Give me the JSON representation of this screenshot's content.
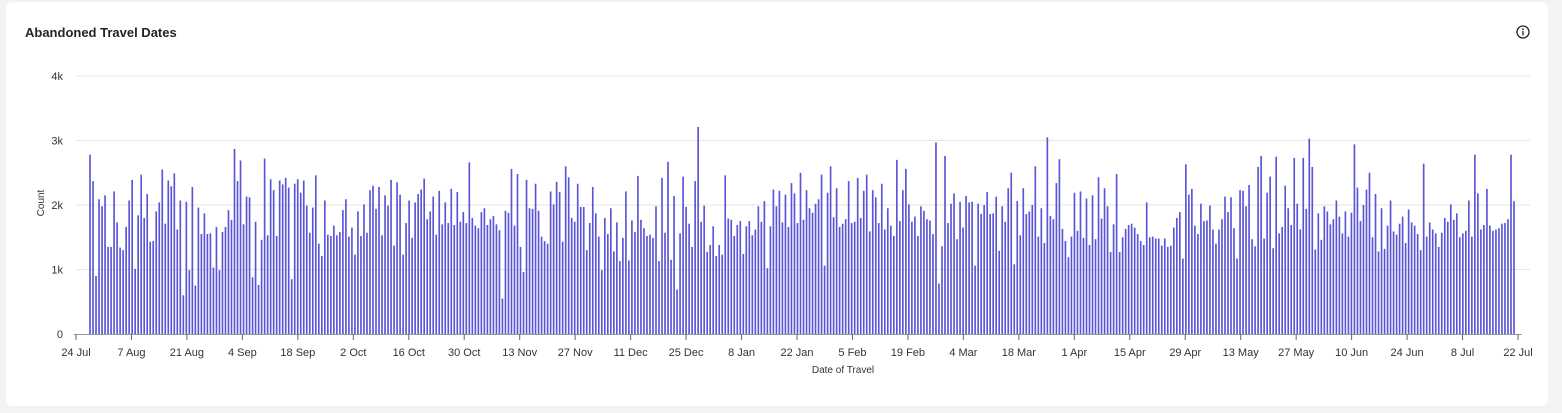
{
  "card": {
    "title": "Abandoned Travel Dates",
    "info_icon": "info-circle-icon"
  },
  "chart_data": {
    "type": "bar",
    "title": "Abandoned Travel Dates",
    "xlabel": "Date of Travel",
    "ylabel": "Count",
    "ylim": [
      0,
      4000
    ],
    "y_ticks": [
      {
        "value": 0,
        "label": "0"
      },
      {
        "value": 1000,
        "label": "1k"
      },
      {
        "value": 2000,
        "label": "2k"
      },
      {
        "value": 3000,
        "label": "3k"
      },
      {
        "value": 4000,
        "label": "4k"
      }
    ],
    "x_ticks": [
      "24 Jul",
      "7 Aug",
      "21 Aug",
      "4 Sep",
      "18 Sep",
      "2 Oct",
      "16 Oct",
      "30 Oct",
      "13 Nov",
      "27 Nov",
      "11 Dec",
      "25 Dec",
      "8 Jan",
      "22 Jan",
      "5 Feb",
      "19 Feb",
      "4 Mar",
      "18 Mar",
      "1 Apr",
      "15 Apr",
      "29 Apr",
      "13 May",
      "27 May",
      "10 Jun",
      "24 Jun",
      "8 Jul",
      "22 Jul"
    ],
    "grid": true,
    "bar_color": "#5a55d6",
    "values": [
      2780,
      2370,
      900,
      2090,
      1980,
      2150,
      1350,
      1350,
      2210,
      1730,
      1340,
      1300,
      1660,
      2070,
      2390,
      1010,
      1840,
      2470,
      1800,
      2170,
      1430,
      1440,
      1900,
      2040,
      2550,
      1710,
      2380,
      2290,
      2490,
      1620,
      2070,
      600,
      2050,
      990,
      2280,
      750,
      1960,
      1550,
      1870,
      1550,
      1560,
      1030,
      1660,
      990,
      1580,
      1660,
      1920,
      1770,
      2870,
      2370,
      2690,
      1700,
      2130,
      2120,
      880,
      1740,
      760,
      1460,
      2720,
      1530,
      2400,
      2230,
      1520,
      2380,
      2320,
      2420,
      2270,
      850,
      2330,
      2400,
      2190,
      2380,
      1990,
      1570,
      1960,
      2460,
      1400,
      1210,
      2070,
      1540,
      1520,
      1680,
      1530,
      1580,
      1920,
      2090,
      1510,
      1650,
      1230,
      1900,
      1520,
      2010,
      1570,
      2230,
      2300,
      1940,
      2280,
      1530,
      2150,
      1990,
      2390,
      1370,
      2350,
      2160,
      1230,
      1720,
      2070,
      1490,
      2040,
      2170,
      2240,
      2410,
      1780,
      1900,
      2130,
      1540,
      2220,
      1700,
      2040,
      1720,
      2250,
      1690,
      2200,
      1740,
      1890,
      1720,
      2660,
      1800,
      1680,
      1640,
      1890,
      1950,
      1690,
      1780,
      1830,
      1700,
      1610,
      550,
      1910,
      1880,
      2560,
      1680,
      2480,
      1350,
      960,
      2390,
      1950,
      1940,
      2330,
      1910,
      1510,
      1440,
      1400,
      2210,
      2010,
      2360,
      2200,
      1430,
      2600,
      2430,
      1800,
      1740,
      2330,
      1970,
      1970,
      1300,
      1720,
      2280,
      1870,
      1510,
      990,
      1800,
      1550,
      1950,
      1280,
      1730,
      1130,
      1490,
      2210,
      1140,
      1760,
      1580,
      2450,
      1770,
      1640,
      1520,
      1540,
      1490,
      1980,
      1130,
      2420,
      1570,
      2670,
      1150,
      2140,
      690,
      1560,
      2440,
      1970,
      1710,
      1350,
      2370,
      3210,
      1740,
      1990,
      1270,
      1380,
      1670,
      1210,
      1380,
      1230,
      2460,
      1790,
      1770,
      1520,
      1690,
      1750,
      1240,
      1670,
      1750,
      1530,
      1620,
      1980,
      1740,
      2060,
      1020,
      1670,
      2240,
      1980,
      2220,
      1730,
      2160,
      1660,
      2340,
      2180,
      1720,
      2500,
      1770,
      2230,
      1950,
      1880,
      2020,
      2090,
      2470,
      1060,
      2190,
      2600,
      1810,
      2260,
      1660,
      1710,
      1780,
      2370,
      1720,
      1740,
      2420,
      1800,
      2220,
      2470,
      1590,
      2230,
      2120,
      1720,
      2330,
      1620,
      1950,
      1680,
      1520,
      2700,
      1750,
      2230,
      2560,
      2010,
      1740,
      1820,
      1520,
      1980,
      1910,
      1780,
      1760,
      1550,
      2970,
      780,
      1360,
      2760,
      1720,
      2020,
      2180,
      1470,
      2050,
      1650,
      2140,
      2040,
      2050,
      1060,
      2020,
      1860,
      2000,
      2200,
      1860,
      1870,
      2130,
      1290,
      1980,
      1740,
      2260,
      2500,
      1080,
      2060,
      1530,
      2260,
      1860,
      1900,
      2000,
      2600,
      1510,
      1950,
      1410,
      3050,
      1830,
      1780,
      2340,
      2710,
      1630,
      1440,
      1190,
      1510,
      2190,
      1600,
      2210,
      1490,
      2100,
      1380,
      2150,
      1470,
      2430,
      1790,
      2260,
      1980,
      1270,
      1700,
      2480,
      1270,
      1500,
      1630,
      1690,
      1710,
      1650,
      1550,
      1440,
      1380,
      2040,
      1500,
      1510,
      1480,
      1480,
      1370,
      1480,
      1350,
      1370,
      1650,
      1800,
      1890,
      1170,
      2630,
      2160,
      2250,
      1680,
      1550,
      2020,
      1750,
      1760,
      1990,
      1620,
      1400,
      1620,
      1780,
      2130,
      1890,
      2120,
      1640,
      1170,
      2230,
      2220,
      1980,
      2310,
      1470,
      1360,
      2590,
      2760,
      1480,
      2190,
      2440,
      1330,
      2750,
      1560,
      1660,
      2300,
      1950,
      1690,
      2730,
      2020,
      1620,
      2730,
      1940,
      3030,
      2590,
      1310,
      1870,
      1460,
      1980,
      1900,
      1700,
      1780,
      2070,
      1820,
      1560,
      1900,
      1510,
      1880,
      2940,
      2270,
      1750,
      2000,
      2240,
      2500,
      1500,
      2170,
      1280,
      1950,
      1320,
      1680,
      2070,
      1590,
      1540,
      1710,
      1820,
      1410,
      1930,
      1730,
      1680,
      1550,
      1300,
      2640,
      1510,
      1730,
      1620,
      1560,
      1350,
      1570,
      1800,
      1740,
      2010,
      1770,
      1870,
      1500,
      1560,
      1600,
      2070,
      1510,
      2780,
      2180,
      1620,
      1690,
      2250,
      1680,
      1600,
      1620,
      1640,
      1710,
      1720,
      1780,
      2780,
      2060
    ]
  }
}
